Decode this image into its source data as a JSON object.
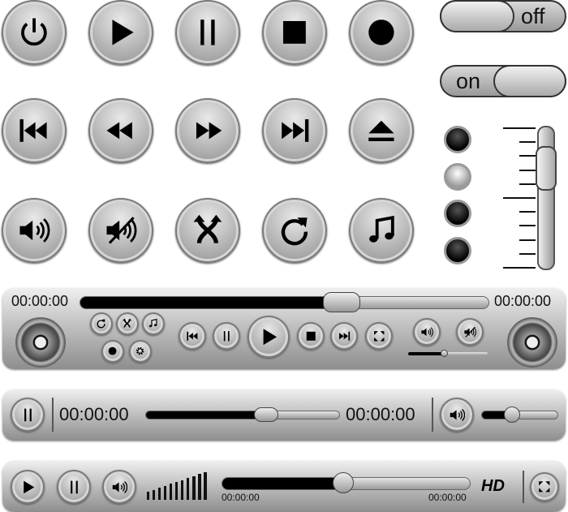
{
  "icon_grid": [
    [
      "power-icon",
      "play-icon",
      "pause-icon",
      "stop-icon",
      "record-icon"
    ],
    [
      "previous-icon",
      "rewind-icon",
      "fast-forward-icon",
      "next-icon",
      "eject-icon"
    ],
    [
      "volume-icon",
      "mute-icon",
      "shuffle-icon",
      "repeat-icon",
      "music-icon"
    ]
  ],
  "toggles": {
    "off_label": "off",
    "on_label": "on"
  },
  "radio_dots": {
    "selected_index": 1,
    "count": 4
  },
  "vertical_slider": {
    "value_percent": 80
  },
  "player1": {
    "time_start": "00:00:00",
    "time_end": "00:00:00",
    "progress_percent": 64,
    "volume_percent": 45
  },
  "player2": {
    "time_start": "00:00:00",
    "time_end": "00:00:00",
    "progress_percent": 62,
    "volume_percent": 40
  },
  "player3": {
    "time_start": "00:00:00",
    "time_end": "00:00:00",
    "progress_percent": 49,
    "hd_label": "HD",
    "volume_level_bars": 11
  },
  "colors": {
    "accent": "#000000",
    "surface": "#bdbdbd"
  }
}
